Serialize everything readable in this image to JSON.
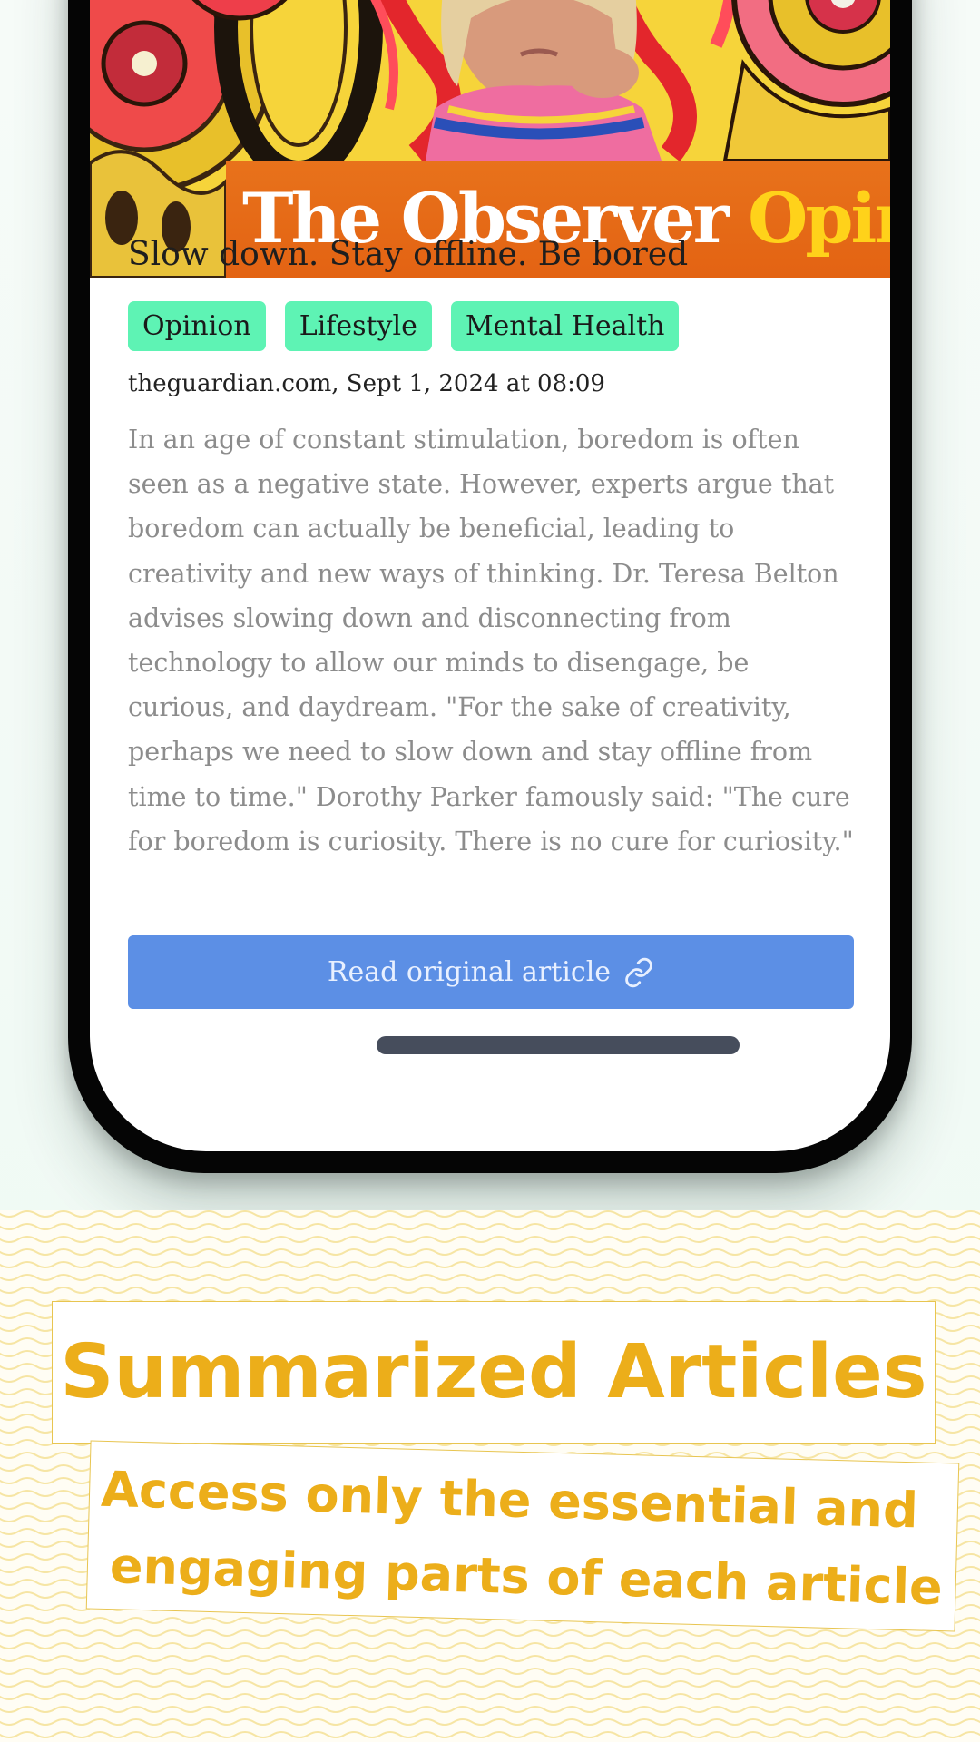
{
  "hero": {
    "title_white": "The Observer",
    "title_yellow": "Opinio",
    "colors": {
      "banner": "#e36313",
      "accent_yellow": "#ffd21a"
    }
  },
  "article": {
    "title": "Slow down. Stay offline. Be bored",
    "tags": [
      "Opinion",
      "Lifestyle",
      "Mental Health"
    ],
    "source_date": "theguardian.com, Sept 1, 2024 at 08:09",
    "summary": "In an age of constant stimulation, boredom is often seen as a negative state. However, experts argue that boredom can actually be beneficial, leading to creativity and new ways of thinking. Dr. Teresa Belton advises slowing down and disconnecting from technology to allow our minds to disengage, be curious, and daydream. \"For the sake of creativity, perhaps we need to slow down and stay offline from time to time.\" Dorothy Parker famously said: \"The cure for boredom is curiosity. There is no cure for curiosity.\"",
    "read_button_label": "Read original article",
    "read_button_icon": "link-icon"
  },
  "promo": {
    "headline": "Summarized Articles",
    "subline_1": "Access only the essential and",
    "subline_2": "engaging parts of each article"
  },
  "colors": {
    "tag_bg": "#5ef3b4",
    "button_bg": "#5c8fe5",
    "promo_text": "#ecae1a"
  }
}
